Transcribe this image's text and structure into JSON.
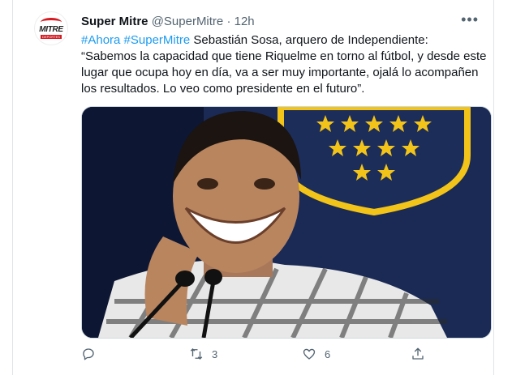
{
  "tweet": {
    "display_name": "Super Mitre",
    "handle": "@SuperMitre",
    "separator": "·",
    "time": "12h",
    "more_label": "•••",
    "hashtags": [
      "#Ahora",
      "#SuperMitre"
    ],
    "body": "Sebastián Sosa, arquero de Independiente: “Sabemos la capacidad que tiene Riquelme en torno al fútbol, y desde este lugar que ocupa hoy en día, va a ser muy importante, ojalá lo acompañen los resultados. Lo veo como presidente en el futuro”."
  },
  "avatar": {
    "logo_text": "MITRE",
    "logo_tag": "DEPORTES"
  },
  "actions": {
    "reply_icon": "reply-icon",
    "retweet_icon": "retweet-icon",
    "retweet_count": "3",
    "like_icon": "like-icon",
    "like_count": "6",
    "share_icon": "share-icon"
  },
  "colors": {
    "accent": "#1d9bf0",
    "text": "#0f1419",
    "muted": "#536471",
    "brand_red": "#d71920",
    "crest_navy": "#1c2d5a",
    "crest_gold": "#f2c318"
  }
}
